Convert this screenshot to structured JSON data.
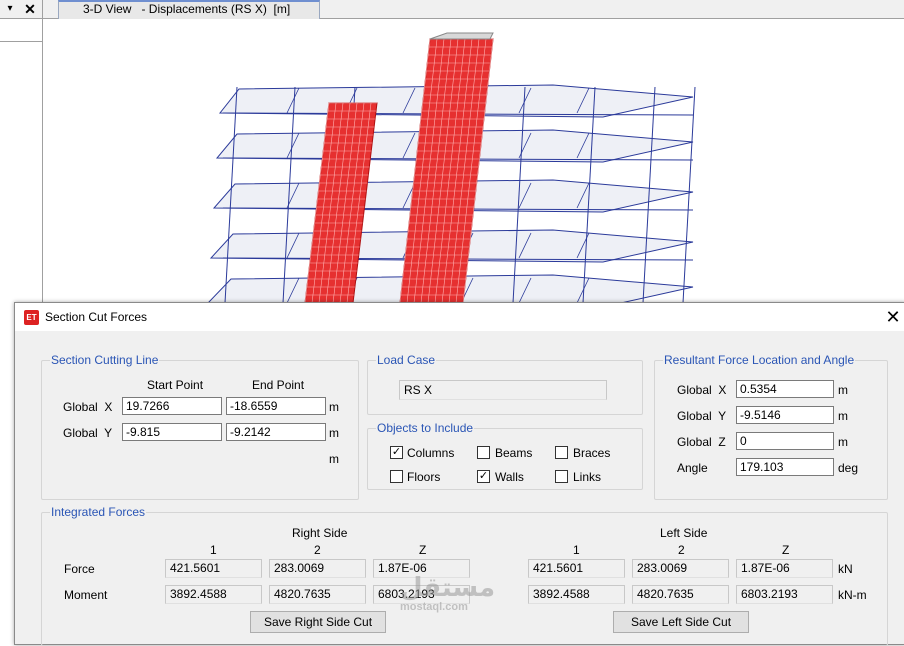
{
  "left_pane": {
    "dropdown_glyph": "▾",
    "close_glyph": "✕"
  },
  "view_tab": {
    "title": "3-D View   - Displacements (RS X)  [m]"
  },
  "model": {
    "wall_color": "#e63030",
    "frame_color": "#2b3a9a"
  },
  "dialog": {
    "icon_text": "ET",
    "title": "Section Cut Forces",
    "close_glyph": "✕",
    "section_cutting_line": {
      "label": "Section Cutting Line",
      "start_point_header": "Start Point",
      "end_point_header": "End Point",
      "global_x_label": "Global  X",
      "global_y_label": "Global  Y",
      "start_x": "19.7266",
      "end_x": "-18.6559",
      "start_y": "-9.815",
      "end_y": "-9.2142",
      "unit_x": "m",
      "unit_y": "m",
      "unit_extra": "m"
    },
    "load_case": {
      "label": "Load Case",
      "value": "RS X"
    },
    "objects_to_include": {
      "label": "Objects to Include",
      "columns": {
        "label": "Columns",
        "checked": true
      },
      "beams": {
        "label": "Beams",
        "checked": false
      },
      "braces": {
        "label": "Braces",
        "checked": false
      },
      "floors": {
        "label": "Floors",
        "checked": false
      },
      "walls": {
        "label": "Walls",
        "checked": true
      },
      "links": {
        "label": "Links",
        "checked": false
      }
    },
    "resultant": {
      "label": "Resultant Force Location and Angle",
      "x_label": "Global  X",
      "y_label": "Global  Y",
      "z_label": "Global  Z",
      "angle_label": "Angle",
      "x": "0.5354",
      "y": "-9.5146",
      "z": "0",
      "angle": "179.103",
      "unit_x": "m",
      "unit_y": "m",
      "unit_z": "m",
      "unit_angle": "deg"
    },
    "integrated_forces": {
      "label": "Integrated Forces",
      "right_side_label": "Right Side",
      "left_side_label": "Left Side",
      "col_1": "1",
      "col_2": "2",
      "col_z": "Z",
      "force_label": "Force",
      "moment_label": "Moment",
      "right_force": [
        "421.5601",
        "283.0069",
        "1.87E-06"
      ],
      "right_moment": [
        "3892.4588",
        "4820.7635",
        "6803.2193"
      ],
      "left_force": [
        "421.5601",
        "283.0069",
        "1.87E-06"
      ],
      "left_moment": [
        "3892.4588",
        "4820.7635",
        "6803.2193"
      ],
      "force_unit": "kN",
      "moment_unit": "kN-m",
      "save_right": "Save Right Side Cut",
      "save_left": "Save Left Side Cut"
    }
  },
  "watermark": {
    "arabic": "مستقل",
    "latin": "mostaql.com"
  }
}
